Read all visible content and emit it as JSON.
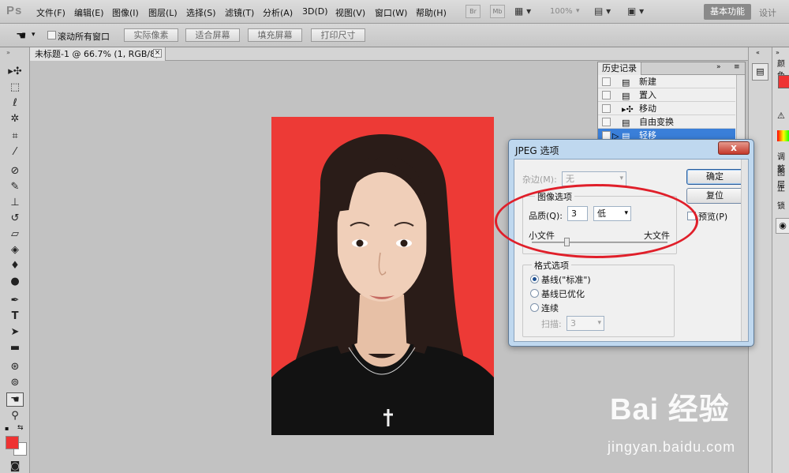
{
  "app": {
    "logo": "Ps"
  },
  "menu": [
    {
      "label": "文件(F)"
    },
    {
      "label": "编辑(E)"
    },
    {
      "label": "图像(I)"
    },
    {
      "label": "图层(L)"
    },
    {
      "label": "选择(S)"
    },
    {
      "label": "滤镜(T)"
    },
    {
      "label": "分析(A)"
    },
    {
      "label": "3D(D)"
    },
    {
      "label": "视图(V)"
    },
    {
      "label": "窗口(W)"
    },
    {
      "label": "帮助(H)"
    }
  ],
  "appbar": {
    "br": "Br",
    "mb": "Mb",
    "zoom": "100%"
  },
  "workspace": {
    "active": "基本功能",
    "other": "设计"
  },
  "options": {
    "scroll_all": "滚动所有窗口",
    "actual_pixels": "实际像素",
    "fit_screen": "适合屏幕",
    "fill_screen": "填充屏幕",
    "print_size": "打印尺寸"
  },
  "document": {
    "tab_title": "未标题-1 @ 66.7% (1, RGB/8) *",
    "close": "×"
  },
  "history": {
    "title": "历史记录",
    "items": [
      {
        "label": "新建"
      },
      {
        "label": "置入"
      },
      {
        "label": "移动"
      },
      {
        "label": "自由变换"
      },
      {
        "label": "轻移"
      }
    ]
  },
  "right_panel": {
    "color_tab": "颜色",
    "adjust_tab": "调整",
    "layers_tab": "图层",
    "normal_mode": "正",
    "lock": "锁"
  },
  "dialog": {
    "title": "JPEG 选项",
    "close": "x",
    "matte_label": "杂边(M):",
    "matte_value": "无",
    "image_options_title": "图像选项",
    "quality_label": "品质(Q):",
    "quality_value": "3",
    "quality_preset": "低",
    "small_file": "小文件",
    "large_file": "大文件",
    "format_title": "格式选项",
    "format_options": [
      {
        "label": "基线(\"标准\")",
        "selected": true
      },
      {
        "label": "基线已优化",
        "selected": false
      },
      {
        "label": "连续",
        "selected": false
      }
    ],
    "scans_label": "扫描:",
    "scans_value": "3",
    "ok": "确定",
    "reset": "复位",
    "preview": "预览(P)",
    "quality_slider_fraction": 0.25
  },
  "colors": {
    "foreground": "#ee3333",
    "background": "#ffffff",
    "photo_background": "#ed3a36",
    "highlight_ellipse": "#e01f2a"
  },
  "watermark": {
    "logo": "Bai 经验",
    "url": "jingyan.baidu.com"
  }
}
